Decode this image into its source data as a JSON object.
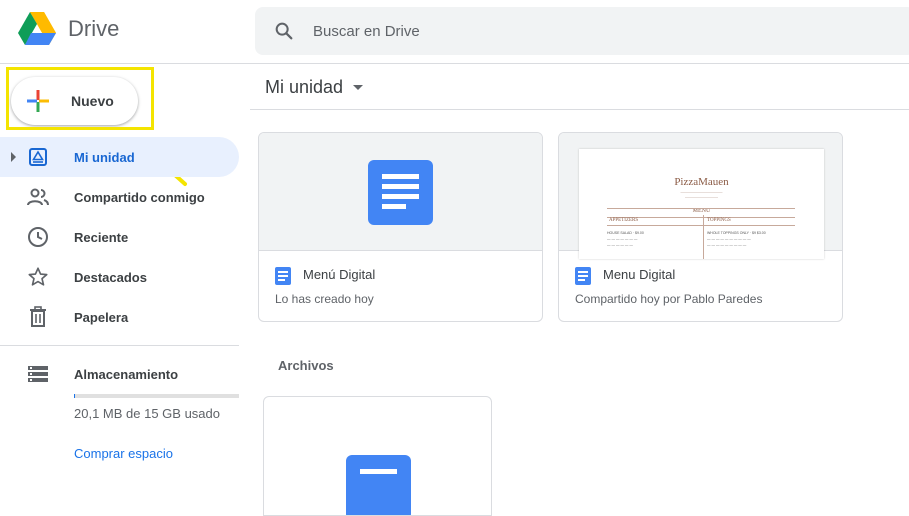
{
  "app": {
    "name": "Drive"
  },
  "search": {
    "placeholder": "Buscar en Drive"
  },
  "new_button": {
    "label": "Nuevo"
  },
  "sidebar": {
    "items": [
      {
        "label": "Mi unidad",
        "icon": "my-drive-icon",
        "active": true
      },
      {
        "label": "Compartido conmigo",
        "icon": "people-icon"
      },
      {
        "label": "Reciente",
        "icon": "clock-icon"
      },
      {
        "label": "Destacados",
        "icon": "star-icon"
      },
      {
        "label": "Papelera",
        "icon": "trash-icon"
      }
    ],
    "storage": {
      "label": "Almacenamiento",
      "usage_text": "20,1 MB de 15 GB usado",
      "used_fraction": 0.0013,
      "buy_link": "Comprar espacio"
    }
  },
  "main": {
    "title": "Mi unidad",
    "quick_access": [
      {
        "name": "Menú Digital",
        "subtitle": "Lo has creado hoy",
        "thumb": "doc-icon"
      },
      {
        "name": "Menu Digital",
        "subtitle": "Compartido hoy por Pablo Paredes",
        "thumb": "document-preview",
        "preview": {
          "title": "PizzaMauen",
          "menu": "MENU",
          "left_heading": "APPETIZERS",
          "right_heading": "TOPPINGS",
          "item1": "HOUSE SALAD · $9.00",
          "item2": "WHOLE TOPPINGS ONLY · $9 $3.00"
        }
      }
    ],
    "files_section": "Archivos"
  },
  "colors": {
    "accent": "#1a73e8",
    "highlight": "#f4e400",
    "doc_blue": "#4285f4",
    "active_bg": "#e8f0fe"
  }
}
